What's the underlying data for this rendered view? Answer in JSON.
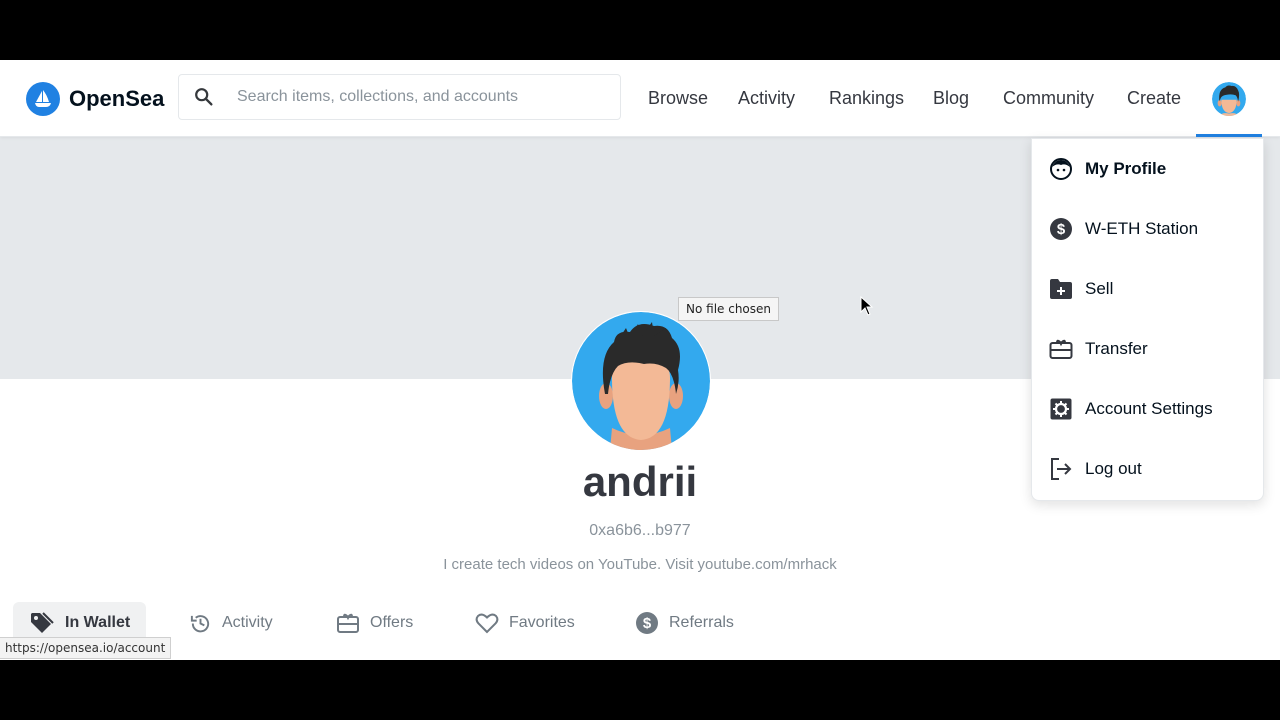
{
  "header": {
    "logo_text": "OpenSea",
    "search_placeholder": "Search items, collections, and accounts",
    "nav": [
      "Browse",
      "Activity",
      "Rankings",
      "Blog",
      "Community",
      "Create"
    ]
  },
  "banner": {
    "file_tooltip": "No file chosen"
  },
  "profile": {
    "username": "andrii",
    "address": "0xa6b6...b977",
    "bio": "I create tech videos on YouTube. Visit youtube.com/mrhack"
  },
  "tabs": [
    "In Wallet",
    "Activity",
    "Offers",
    "Favorites",
    "Referrals"
  ],
  "status_url": "https://opensea.io/account",
  "dropdown": {
    "items": [
      {
        "label": "My Profile",
        "icon": "face-icon"
      },
      {
        "label": "W-ETH Station",
        "icon": "dollar-icon"
      },
      {
        "label": "Sell",
        "icon": "folder-plus-icon"
      },
      {
        "label": "Transfer",
        "icon": "gift-card-icon"
      },
      {
        "label": "Account Settings",
        "icon": "settings-icon"
      },
      {
        "label": "Log out",
        "icon": "logout-icon"
      }
    ]
  },
  "colors": {
    "accent": "#2081e2",
    "banner": "#e5e8eb",
    "avatar_bg": "#33a9ee"
  }
}
